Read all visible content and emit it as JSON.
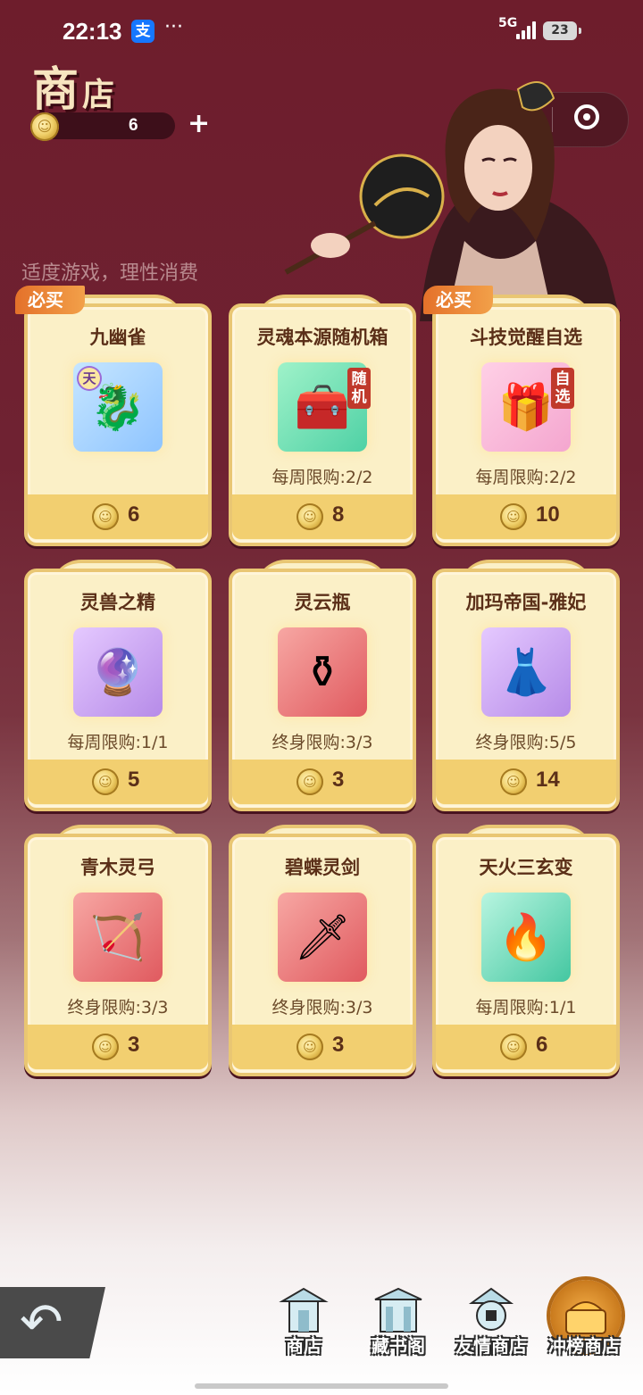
{
  "status_bar": {
    "time": "22:13",
    "alipay_icon": "支",
    "dots": "···",
    "network": "5G",
    "battery": "23"
  },
  "header": {
    "title_big": "商",
    "title_small": "店",
    "coin_balance": "6",
    "add_label": "+"
  },
  "capsule": {
    "more": "•••"
  },
  "slogan": "适度游戏，理性消费",
  "cards": [
    {
      "name": "九幽雀",
      "badge": "必买",
      "limit": "",
      "price": "6",
      "tag": "",
      "tian": "天",
      "glyph": "🐉"
    },
    {
      "name": "灵魂本源随机箱",
      "badge": "",
      "limit": "每周限购:2/2",
      "price": "8",
      "tag": "随机",
      "tian": "",
      "glyph": "🧰"
    },
    {
      "name": "斗技觉醒自选",
      "badge": "必买",
      "limit": "每周限购:2/2",
      "price": "10",
      "tag": "自选",
      "tian": "",
      "glyph": "🎁"
    },
    {
      "name": "灵兽之精",
      "badge": "",
      "limit": "每周限购:1/1",
      "price": "5",
      "tag": "",
      "tian": "",
      "glyph": "🔮"
    },
    {
      "name": "灵云瓶",
      "badge": "",
      "limit": "终身限购:3/3",
      "price": "3",
      "tag": "",
      "tian": "",
      "glyph": "⚱"
    },
    {
      "name": "加玛帝国-雅妃",
      "badge": "",
      "limit": "终身限购:5/5",
      "price": "14",
      "tag": "",
      "tian": "",
      "glyph": "👗"
    },
    {
      "name": "青木灵弓",
      "badge": "",
      "limit": "终身限购:3/3",
      "price": "3",
      "tag": "",
      "tian": "",
      "glyph": "🏹"
    },
    {
      "name": "碧蝶灵剑",
      "badge": "",
      "limit": "终身限购:3/3",
      "price": "3",
      "tag": "",
      "tian": "",
      "glyph": "🗡"
    },
    {
      "name": "天火三玄变",
      "badge": "",
      "limit": "每周限购:1/1",
      "price": "6",
      "tag": "",
      "tian": "",
      "glyph": "🔥"
    }
  ],
  "bottom_nav": [
    {
      "label": "商店"
    },
    {
      "label": "藏书阁"
    },
    {
      "label": "友情商店"
    },
    {
      "label": "冲榜商店"
    }
  ],
  "colors": {
    "background_top": "#6e1d2c",
    "card_bg": "#fbf0c7",
    "card_border": "#e9c673",
    "price_bar": "#f2cf70",
    "badge": "#e4712a"
  }
}
